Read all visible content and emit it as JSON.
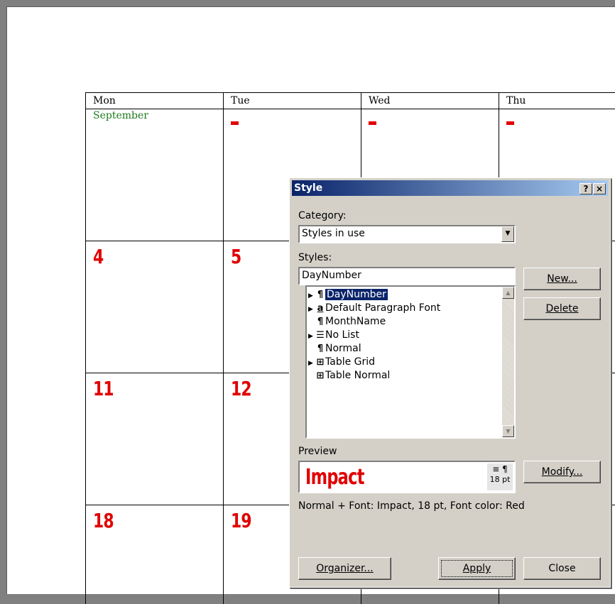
{
  "calendar": {
    "headers": [
      "Mon",
      "Tue",
      "Wed",
      "Thu"
    ],
    "month_name": "September",
    "week1_dashes": [
      "-",
      "-",
      "-"
    ],
    "week2": [
      "4",
      "5"
    ],
    "week3": [
      "11",
      "12"
    ],
    "week4": [
      "18",
      "19"
    ]
  },
  "dialog": {
    "title": "Style",
    "help_label": "?",
    "close_label": "×",
    "category_label": "Category:",
    "category_value": "Styles in use",
    "styles_label": "Styles:",
    "styles_input": "DayNumber",
    "styles_list": [
      {
        "label": "DayNumber",
        "marker": "▶",
        "symbol": "¶",
        "selected": true
      },
      {
        "label": "Default Paragraph Font",
        "marker": "▶",
        "symbol": "a",
        "selected": false
      },
      {
        "label": "MonthName",
        "marker": "",
        "symbol": "¶",
        "selected": false
      },
      {
        "label": "No List",
        "marker": "▶",
        "symbol": "☰",
        "selected": false
      },
      {
        "label": "Normal",
        "marker": "",
        "symbol": "¶",
        "selected": false
      },
      {
        "label": "Table Grid",
        "marker": "▶",
        "symbol": "⊞",
        "selected": false
      },
      {
        "label": "Table Normal",
        "marker": "",
        "symbol": "⊞",
        "selected": false
      }
    ],
    "new_button": "New...",
    "delete_button": "Delete",
    "preview_label": "Preview",
    "preview_text": "Impact",
    "preview_size": "18 pt",
    "modify_button": "Modify...",
    "description": "Normal + Font: Impact, 18 pt, Font color: Red",
    "organizer_button": "Organizer...",
    "apply_button": "Apply",
    "close_button": "Close",
    "colors": {
      "title_start": "#0a246a",
      "title_end": "#a6caf0",
      "day_number": "#e00000",
      "month_name": "#1a7a1a"
    }
  }
}
